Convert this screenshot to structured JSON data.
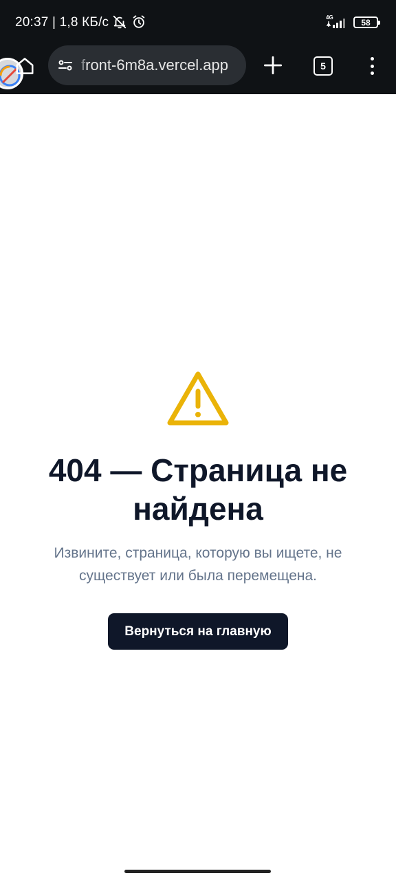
{
  "status_bar": {
    "time": "20:37 | 1,8 КБ/с",
    "network_type": "4G",
    "battery": "58"
  },
  "browser": {
    "url_first_char": "f",
    "url_rest": "ront-6m8a.vercel.app",
    "tab_count": "5"
  },
  "page": {
    "title": "404 — Страница не найдена",
    "subtitle": "Извините, страница, которую вы ищете, не существует или была перемещена.",
    "button_label": "Вернуться на главную"
  },
  "colors": {
    "warning_icon": "#eab308",
    "primary_button": "#0f1729",
    "title_text": "#0f1729",
    "subtitle_text": "#64748b"
  },
  "icons": [
    "bell-off-icon",
    "alarm-icon",
    "signal-icon",
    "battery-icon",
    "home-icon",
    "site-settings-icon",
    "plus-icon",
    "tabs-icon",
    "more-icon",
    "warning-icon"
  ]
}
